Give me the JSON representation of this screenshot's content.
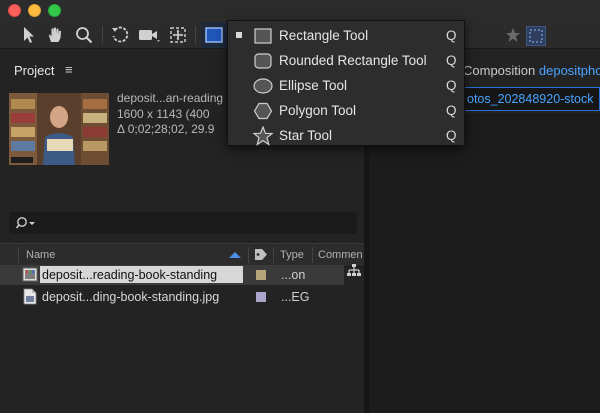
{
  "toolbar": {
    "icons": [
      "arrow-icon",
      "hand-icon",
      "zoom-icon",
      "rotate-icon",
      "camera-icon",
      "pan-behind-icon",
      "rectangle-tool-icon",
      "star-icon",
      "snapping-icon"
    ]
  },
  "project_panel": {
    "title": "Project",
    "menu_glyph": "≡",
    "selected_info": {
      "name": "deposit...an-reading",
      "dimensions": "1600 x 1143  (400",
      "duration": "Δ 0;02;28;02, 29.9"
    },
    "search": {
      "placeholder": ""
    },
    "columns": {
      "name": "Name",
      "type": "Type",
      "comment": "Commen"
    },
    "items": [
      {
        "name": "deposit...reading-book-standing",
        "type": "...on",
        "label_color": "#b7a57a",
        "icon": "composition-icon"
      },
      {
        "name": "deposit...ding-book-standing.jpg",
        "type": "...EG",
        "label_color": "#a9a6c9",
        "icon": "image-file-icon"
      }
    ]
  },
  "composition_panel": {
    "label_prefix": "Composition",
    "label_name": "depositphoto",
    "tab_name": "otos_202848920-stock"
  },
  "shape_menu": {
    "items": [
      {
        "label": "Rectangle Tool",
        "key": "Q",
        "checked": true
      },
      {
        "label": "Rounded Rectangle Tool",
        "key": "Q",
        "checked": false
      },
      {
        "label": "Ellipse Tool",
        "key": "Q",
        "checked": false
      },
      {
        "label": "Polygon Tool",
        "key": "Q",
        "checked": false
      },
      {
        "label": "Star Tool",
        "key": "Q",
        "checked": false
      }
    ]
  },
  "colors": {
    "accent": "#4aa3ff",
    "panel_bg": "#232323",
    "selection": "#d7d7d7"
  }
}
